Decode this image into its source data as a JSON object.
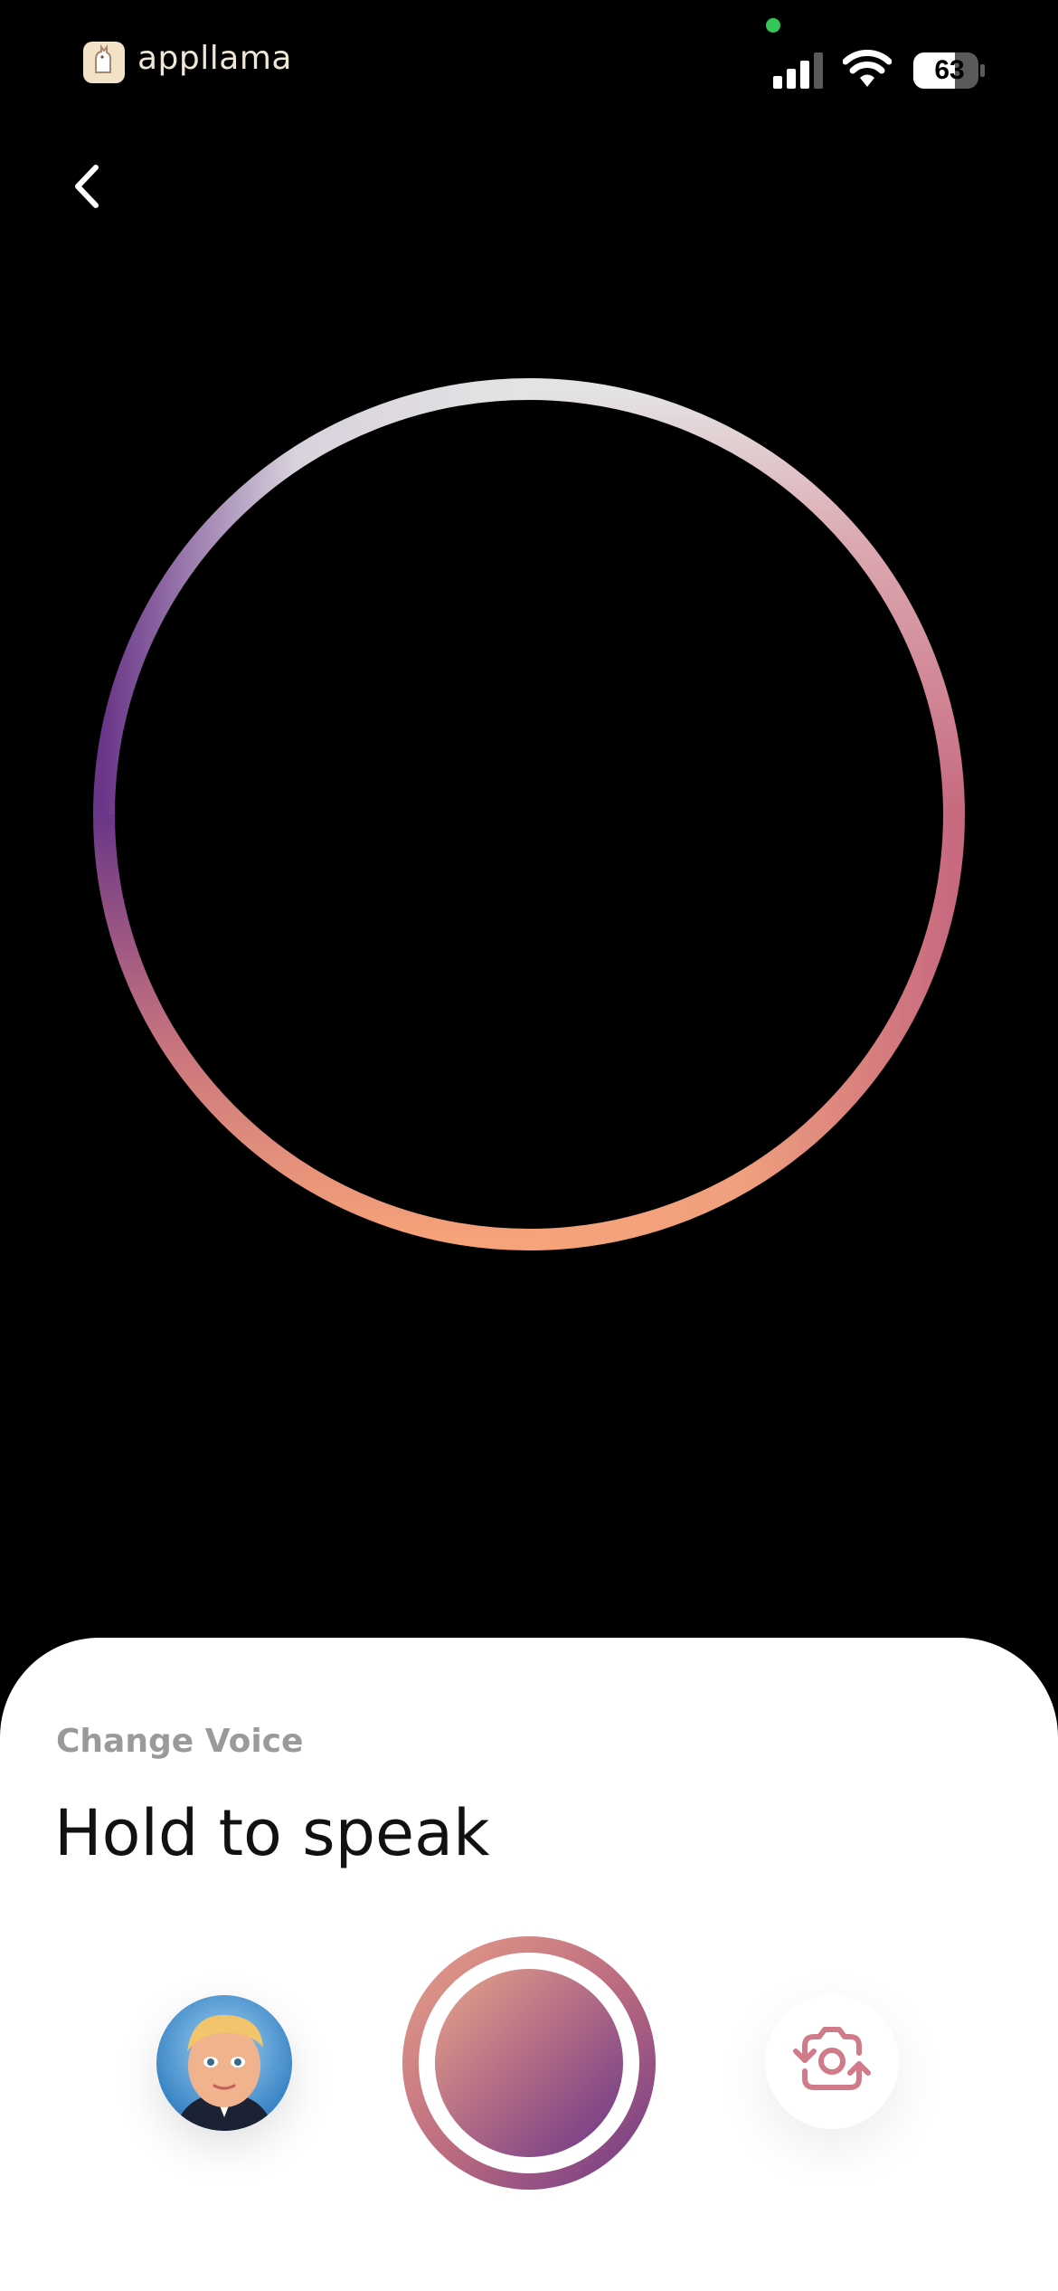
{
  "status_bar": {
    "app_name": "appllama",
    "battery_level": "63"
  },
  "icons": {
    "back": "chevron-left-icon",
    "signal": "cellular-signal-icon",
    "wifi": "wifi-icon",
    "battery": "battery-icon",
    "switch": "camera-switch-icon"
  },
  "sheet": {
    "caption": "Change Voice",
    "title": "Hold to speak"
  },
  "colors": {
    "background": "#000000",
    "sheet": "#ffffff",
    "ring_gradient": [
      "#e2e2e2",
      "#6a3688",
      "#f7a57c",
      "#c7697f"
    ],
    "accent": "#c9708a"
  }
}
